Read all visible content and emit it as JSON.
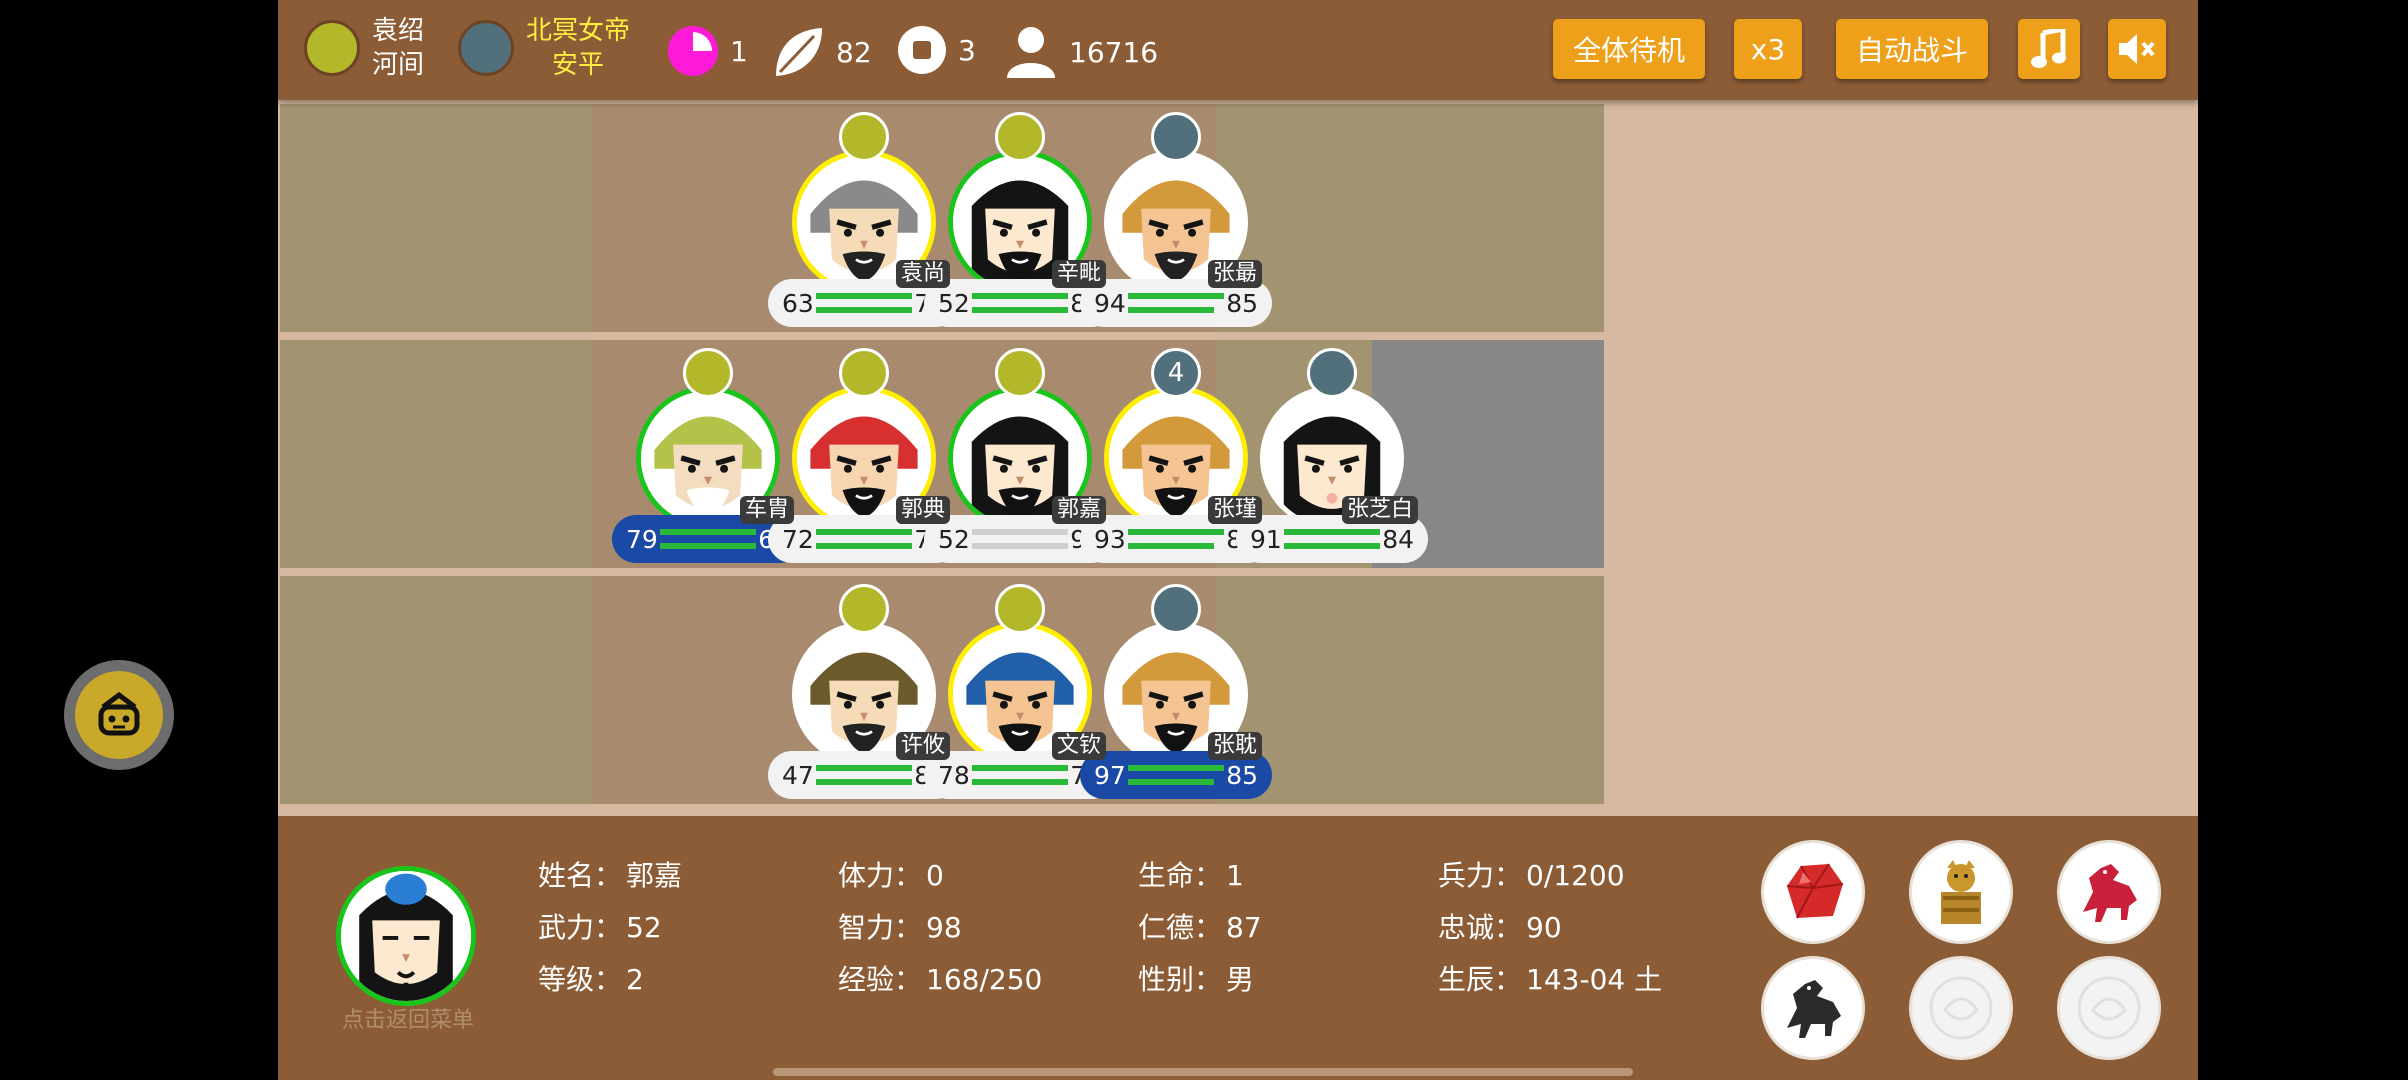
{
  "topbar": {
    "factions": [
      {
        "color": "#b3b82a",
        "line1": "袁绍",
        "line2": "河间"
      },
      {
        "color": "#51707c",
        "line1": "北冥女帝",
        "line2": "安平"
      }
    ],
    "stats": [
      {
        "icon": "clock-pie-icon",
        "value": "1"
      },
      {
        "icon": "leaf-icon",
        "value": "82"
      },
      {
        "icon": "square-stop-icon",
        "value": "3"
      },
      {
        "icon": "person-icon",
        "value": "16716"
      }
    ],
    "buttons": {
      "all_standby": "全体待机",
      "speed": "x3",
      "auto_battle": "自动战斗",
      "music_icon": "music-note-icon",
      "mute_icon": "speaker-mute-icon"
    }
  },
  "colors": {
    "yellow_faction": "#b3b82a",
    "blue_faction": "#51707c",
    "ring_yellow": "#ffee00",
    "ring_green": "#19c51a",
    "button_orange": "#efa01a",
    "selected_blue": "#1a49a6"
  },
  "board": {
    "rows": 3,
    "cols": 8,
    "units": [
      {
        "name": "袁尚",
        "atk": "63",
        "int": "75",
        "flag": "yellow",
        "ring": "yellow",
        "flag_text": "",
        "selected": false,
        "hp": [
          1,
          1
        ]
      },
      {
        "name": "辛毗",
        "atk": "52",
        "int": "84",
        "flag": "yellow",
        "ring": "green",
        "flag_text": "",
        "selected": false,
        "hp": [
          1,
          1
        ]
      },
      {
        "name": "张朂",
        "atk": "94",
        "int": "85",
        "flag": "blue",
        "ring": "none",
        "flag_text": "",
        "selected": false,
        "hp": [
          1,
          0.9
        ]
      },
      {
        "name": "车胄",
        "atk": "79",
        "int": "65",
        "flag": "yellow",
        "ring": "green",
        "flag_text": "",
        "selected": true,
        "hp": [
          1,
          1
        ]
      },
      {
        "name": "郭典",
        "atk": "72",
        "int": "73",
        "flag": "yellow",
        "ring": "yellow",
        "flag_text": "",
        "selected": false,
        "hp": [
          1,
          1
        ]
      },
      {
        "name": "郭嘉",
        "atk": "52",
        "int": "98",
        "flag": "yellow",
        "ring": "green",
        "flag_text": "",
        "selected": false,
        "hp": [
          0,
          0
        ]
      },
      {
        "name": "张瑾",
        "atk": "93",
        "int": "86",
        "flag": "blue",
        "ring": "yellow",
        "flag_text": "4",
        "selected": false,
        "hp": [
          1,
          0.9
        ]
      },
      {
        "name": "张芝白",
        "atk": "91",
        "int": "84",
        "flag": "blue",
        "ring": "none",
        "flag_text": "",
        "selected": false,
        "hp": [
          1,
          1
        ]
      },
      {
        "name": "许攸",
        "atk": "47",
        "int": "88",
        "flag": "yellow",
        "ring": "none",
        "flag_text": "",
        "selected": false,
        "hp": [
          1,
          1
        ]
      },
      {
        "name": "文钦",
        "atk": "78",
        "int": "73",
        "flag": "yellow",
        "ring": "yellow",
        "flag_text": "",
        "selected": false,
        "hp": [
          1,
          1
        ]
      },
      {
        "name": "张耽",
        "atk": "97",
        "int": "85",
        "flag": "blue",
        "ring": "none",
        "flag_text": "",
        "selected": true,
        "hp": [
          1,
          0.9
        ]
      }
    ]
  },
  "selected": {
    "back_text": "点击返回菜单",
    "fields": [
      {
        "label": "姓名：",
        "value": "郭嘉"
      },
      {
        "label": "体力：",
        "value": "0"
      },
      {
        "label": "生命：",
        "value": "1"
      },
      {
        "label": "兵力：",
        "value": "0/1200"
      },
      {
        "label": "武力：",
        "value": "52"
      },
      {
        "label": "智力：",
        "value": "98"
      },
      {
        "label": "仁德：",
        "value": "87"
      },
      {
        "label": "忠诚：",
        "value": "90"
      },
      {
        "label": "等级：",
        "value": "2"
      },
      {
        "label": "经验：",
        "value": "168/250"
      },
      {
        "label": "性别：",
        "value": "男"
      },
      {
        "label": "生辰：",
        "value": "143-04 土"
      }
    ],
    "items": [
      "red-gem-icon",
      "treasure-chest-icon",
      "red-horse-icon",
      "black-horse-icon",
      "empty-slot-icon",
      "empty-slot-icon"
    ]
  },
  "float_button": {
    "icon": "fish-face-icon"
  }
}
